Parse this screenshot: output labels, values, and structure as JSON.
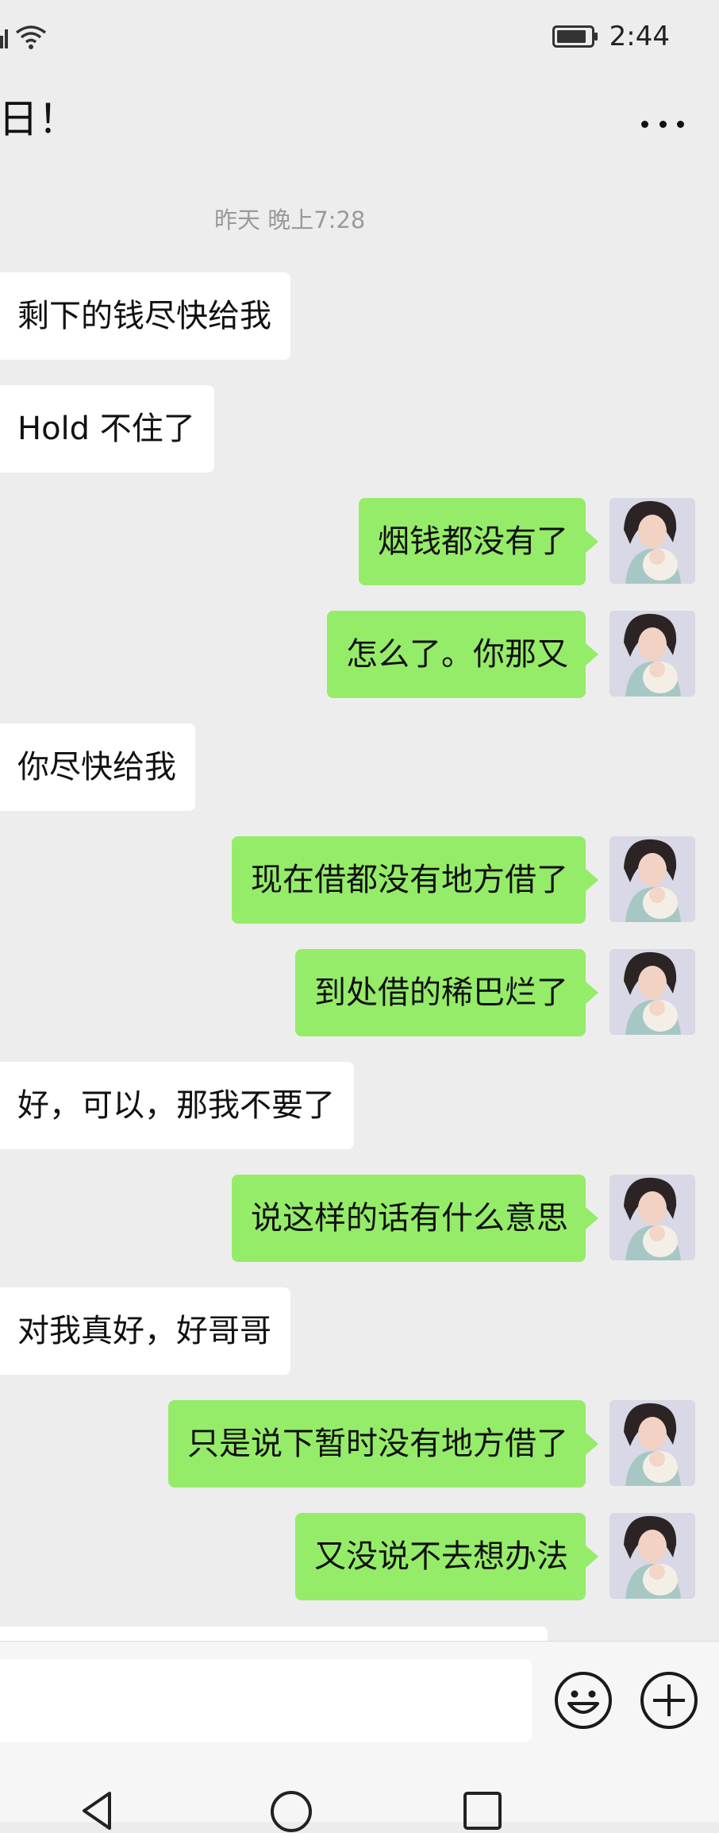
{
  "status_bar": {
    "time": "2:44"
  },
  "header": {
    "title": "日！"
  },
  "chat": {
    "timestamp": "昨天 晚上7:28",
    "messages": [
      {
        "side": "in",
        "text": "剩下的钱尽快给我"
      },
      {
        "side": "in",
        "text": "Hold 不住了"
      },
      {
        "side": "out",
        "text": "烟钱都没有了"
      },
      {
        "side": "out",
        "text": "怎么了。你那又"
      },
      {
        "side": "in",
        "text": "你尽快给我"
      },
      {
        "side": "out",
        "text": "现在借都没有地方借了"
      },
      {
        "side": "out",
        "text": "到处借的稀巴烂了"
      },
      {
        "side": "in",
        "text": "好，可以，那我不要了"
      },
      {
        "side": "out",
        "text": "说这样的话有什么意思"
      },
      {
        "side": "in",
        "text": "对我真好，好哥哥"
      },
      {
        "side": "out",
        "text": "只是说下暂时没有地方借了"
      },
      {
        "side": "out",
        "text": "又没说不去想办法"
      }
    ]
  },
  "input_bar": {
    "value": "",
    "placeholder": ""
  },
  "icons": {
    "signal": "signal-icon",
    "wifi": "wifi-icon",
    "battery": "battery-icon",
    "more": "more-dots-icon",
    "emoji": "emoji-icon",
    "plus": "plus-circle-icon",
    "back": "nav-back-icon",
    "home": "nav-home-icon",
    "recent": "nav-recent-icon"
  },
  "colors": {
    "background": "#ededed",
    "outgoing_bubble": "#95ec69",
    "incoming_bubble": "#ffffff",
    "timestamp": "#9a9a9a"
  }
}
